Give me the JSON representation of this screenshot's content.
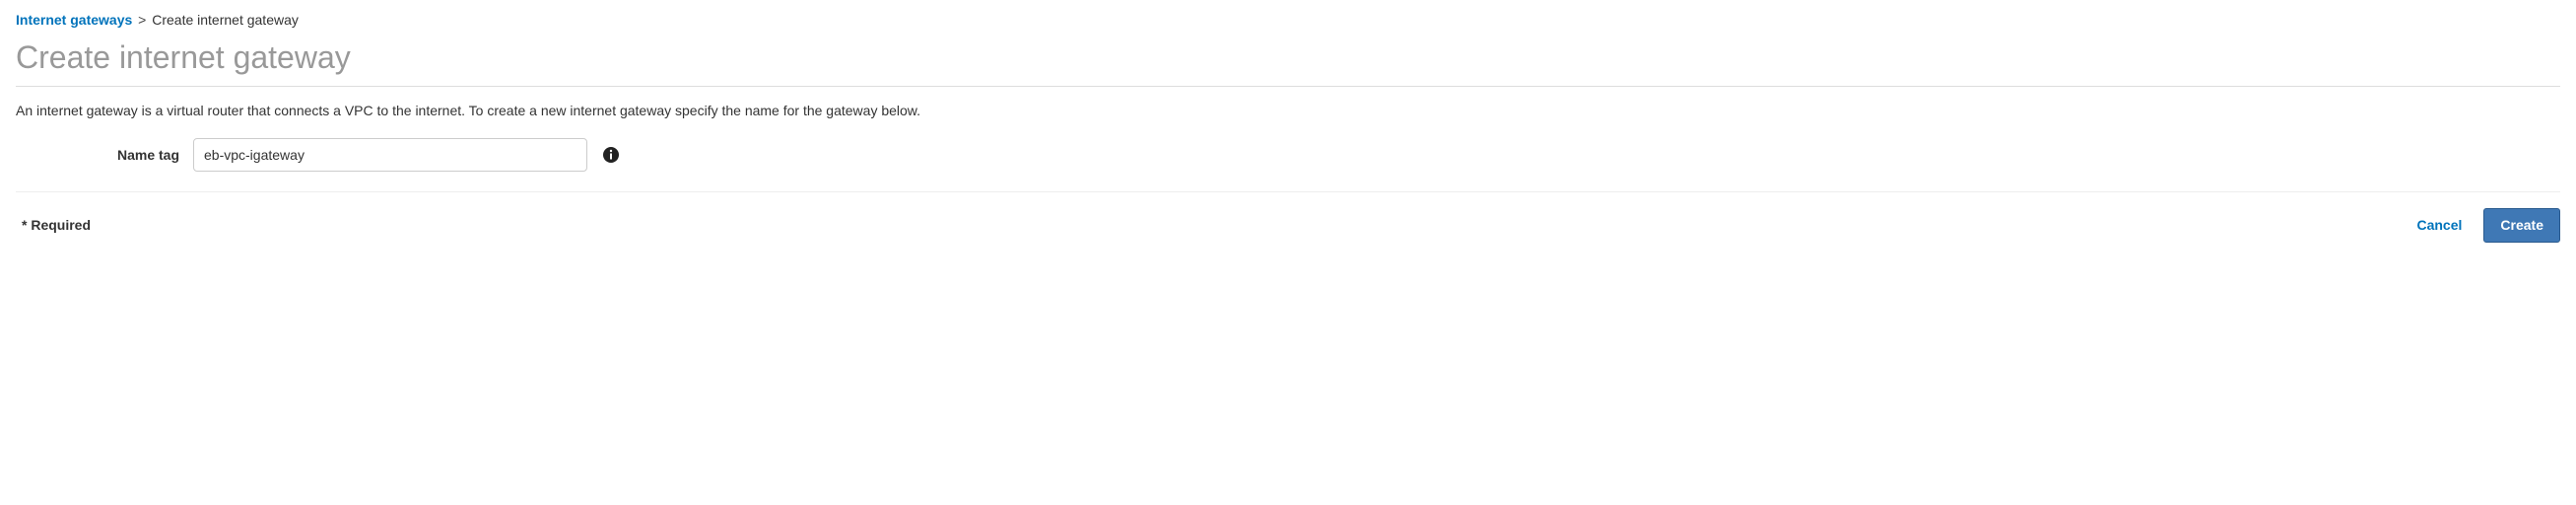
{
  "breadcrumb": {
    "parent_label": "Internet gateways",
    "separator": ">",
    "current_label": "Create internet gateway"
  },
  "page": {
    "title": "Create internet gateway",
    "description": "An internet gateway is a virtual router that connects a VPC to the internet. To create a new internet gateway specify the name for the gateway below."
  },
  "form": {
    "name_tag_label": "Name tag",
    "name_tag_value": "eb-vpc-igateway"
  },
  "footer": {
    "required_label": "* Required",
    "cancel_label": "Cancel",
    "create_label": "Create"
  }
}
